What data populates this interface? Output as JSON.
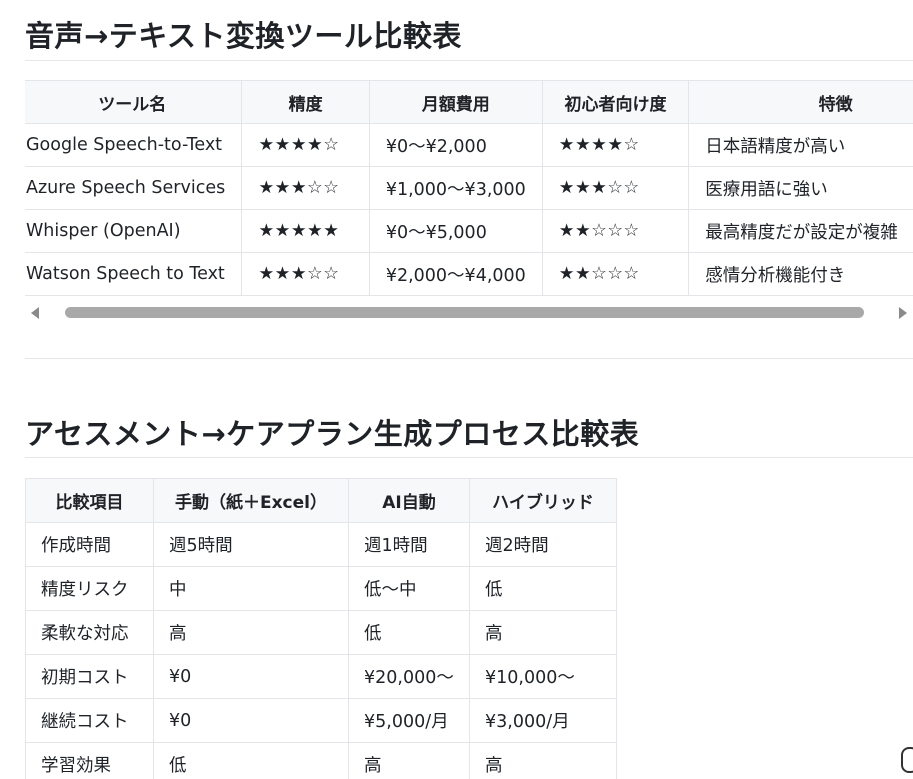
{
  "section1": {
    "title": "音声→テキスト変換ツール比較表",
    "headers": [
      "ツール名",
      "精度",
      "月額費用",
      "初心者向け度",
      "特徴"
    ],
    "rows": [
      [
        "Google Speech-to-Text",
        "★★★★☆",
        "¥0〜¥2,000",
        "★★★★☆",
        "日本語精度が高い"
      ],
      [
        "Azure Speech Services",
        "★★★☆☆",
        "¥1,000〜¥3,000",
        "★★★☆☆",
        "医療用語に強い"
      ],
      [
        "Whisper (OpenAI)",
        "★★★★★",
        "¥0〜¥5,000",
        "★★☆☆☆",
        "最高精度だが設定が複雑"
      ],
      [
        "Watson Speech to Text",
        "★★★☆☆",
        "¥2,000〜¥4,000",
        "★★☆☆☆",
        "感情分析機能付き"
      ]
    ]
  },
  "section2": {
    "title": "アセスメント→ケアプラン生成プロセス比較表",
    "headers": [
      "比較項目",
      "手動（紙＋Excel）",
      "AI自動",
      "ハイブリッド"
    ],
    "rows": [
      [
        "作成時間",
        "週5時間",
        "週1時間",
        "週2時間"
      ],
      [
        "精度リスク",
        "中",
        "低〜中",
        "低"
      ],
      [
        "柔軟な対応",
        "高",
        "低",
        "高"
      ],
      [
        "初期コスト",
        "¥0",
        "¥20,000〜",
        "¥10,000〜"
      ],
      [
        "継続コスト",
        "¥0",
        "¥5,000/月",
        "¥3,000/月"
      ],
      [
        "学習効果",
        "低",
        "高",
        "高"
      ]
    ]
  }
}
